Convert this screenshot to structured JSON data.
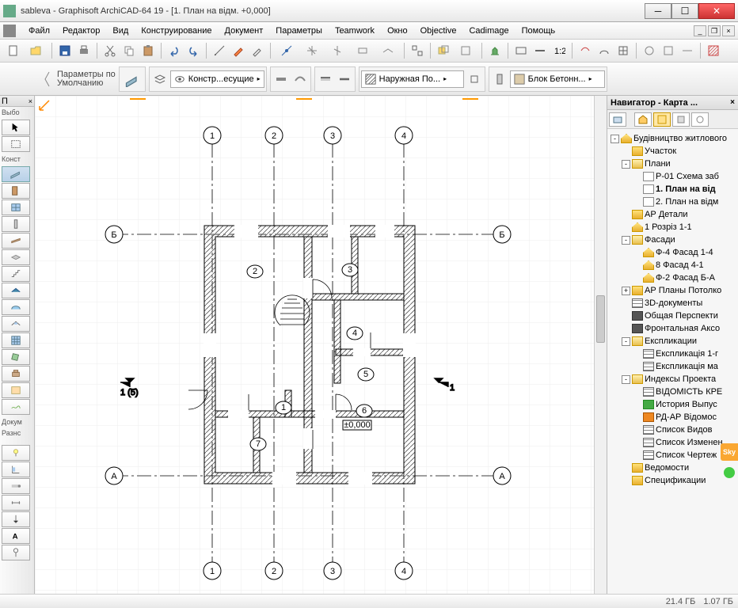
{
  "window": {
    "title": "sableva - Graphisoft ArchiCAD-64 19 - [1. План на відм. +0,000]"
  },
  "menu": [
    "Файл",
    "Редактор",
    "Вид",
    "Конструирование",
    "Документ",
    "Параметры",
    "Teamwork",
    "Окно",
    "Objective",
    "Cadimage",
    "Помощь"
  ],
  "optbar": {
    "params_label_1": "Параметры по",
    "params_label_2": "Умолчанию",
    "layer_drop": "Констр...есущие",
    "wall_drop": "Наружная По...",
    "material_drop": "Блок Бетонн..."
  },
  "left_palette": {
    "header": "П",
    "label1": "Выбо",
    "label2": "Конст",
    "label3": "Докум",
    "label4": "Разнс"
  },
  "navigator": {
    "title": "Навигатор - Карта ...",
    "tree": [
      {
        "depth": 0,
        "toggle": "-",
        "icon": "house-icon",
        "label": "Будівництво житлового"
      },
      {
        "depth": 1,
        "toggle": "",
        "icon": "folder-yellow",
        "label": "Участок"
      },
      {
        "depth": 1,
        "toggle": "-",
        "icon": "folder-open",
        "label": "Плани"
      },
      {
        "depth": 2,
        "toggle": "",
        "icon": "doc-icon",
        "label": "Р-01 Схема заб"
      },
      {
        "depth": 2,
        "toggle": "",
        "icon": "doc-icon",
        "label": "1. План на від",
        "bold": true
      },
      {
        "depth": 2,
        "toggle": "",
        "icon": "doc-icon",
        "label": "2. План на відм"
      },
      {
        "depth": 1,
        "toggle": "",
        "icon": "folder-yellow",
        "label": "АР Детали"
      },
      {
        "depth": 1,
        "toggle": "",
        "icon": "house-icon",
        "label": "1 Розріз 1-1"
      },
      {
        "depth": 1,
        "toggle": "-",
        "icon": "folder-open",
        "label": "Фасади"
      },
      {
        "depth": 2,
        "toggle": "",
        "icon": "house-icon",
        "label": "Ф-4 Фасад 1-4"
      },
      {
        "depth": 2,
        "toggle": "",
        "icon": "house-icon",
        "label": "8 Фасад 4-1"
      },
      {
        "depth": 2,
        "toggle": "",
        "icon": "house-icon",
        "label": "Ф-2 Фасад Б-А"
      },
      {
        "depth": 1,
        "toggle": "+",
        "icon": "folder-yellow",
        "label": "АР Планы Потолко"
      },
      {
        "depth": 1,
        "toggle": "",
        "icon": "grid-icon",
        "label": "3D-документы"
      },
      {
        "depth": 1,
        "toggle": "",
        "icon": "cam-icon",
        "label": "Общая Перспекти"
      },
      {
        "depth": 1,
        "toggle": "",
        "icon": "cam-icon",
        "label": "Фронтальная Аксо"
      },
      {
        "depth": 1,
        "toggle": "-",
        "icon": "folder-open",
        "label": "Експликации"
      },
      {
        "depth": 2,
        "toggle": "",
        "icon": "grid-icon",
        "label": "Експликація 1-г"
      },
      {
        "depth": 2,
        "toggle": "",
        "icon": "grid-icon",
        "label": "Експликація ма"
      },
      {
        "depth": 1,
        "toggle": "-",
        "icon": "folder-open",
        "label": "Индексы Проекта"
      },
      {
        "depth": 2,
        "toggle": "",
        "icon": "grid-icon",
        "label": "ВІДОМІСТЬ КРЕ"
      },
      {
        "depth": 2,
        "toggle": "",
        "icon": "green-icon",
        "label": "История Выпус"
      },
      {
        "depth": 2,
        "toggle": "",
        "icon": "orange-icon",
        "label": "РД-АР Відомос"
      },
      {
        "depth": 2,
        "toggle": "",
        "icon": "grid-icon",
        "label": "Список Видов"
      },
      {
        "depth": 2,
        "toggle": "",
        "icon": "grid-icon",
        "label": "Список Изменен"
      },
      {
        "depth": 2,
        "toggle": "",
        "icon": "grid-icon",
        "label": "Список Чертеж"
      },
      {
        "depth": 1,
        "toggle": "",
        "icon": "folder-yellow",
        "label": "Ведомости"
      },
      {
        "depth": 1,
        "toggle": "",
        "icon": "folder-yellow",
        "label": "Спецификации"
      }
    ]
  },
  "plan": {
    "col_bubbles": [
      "1",
      "2",
      "3",
      "4"
    ],
    "row_bubbles": [
      "Б",
      "А"
    ],
    "rooms": [
      "1",
      "2",
      "3",
      "4",
      "5",
      "6",
      "7"
    ],
    "level_tag": "±0,000",
    "section_left": "1 (5)",
    "section_right": "1"
  },
  "status": {
    "mem1": "21.4 ГБ",
    "mem2": "1.07 ГБ"
  }
}
